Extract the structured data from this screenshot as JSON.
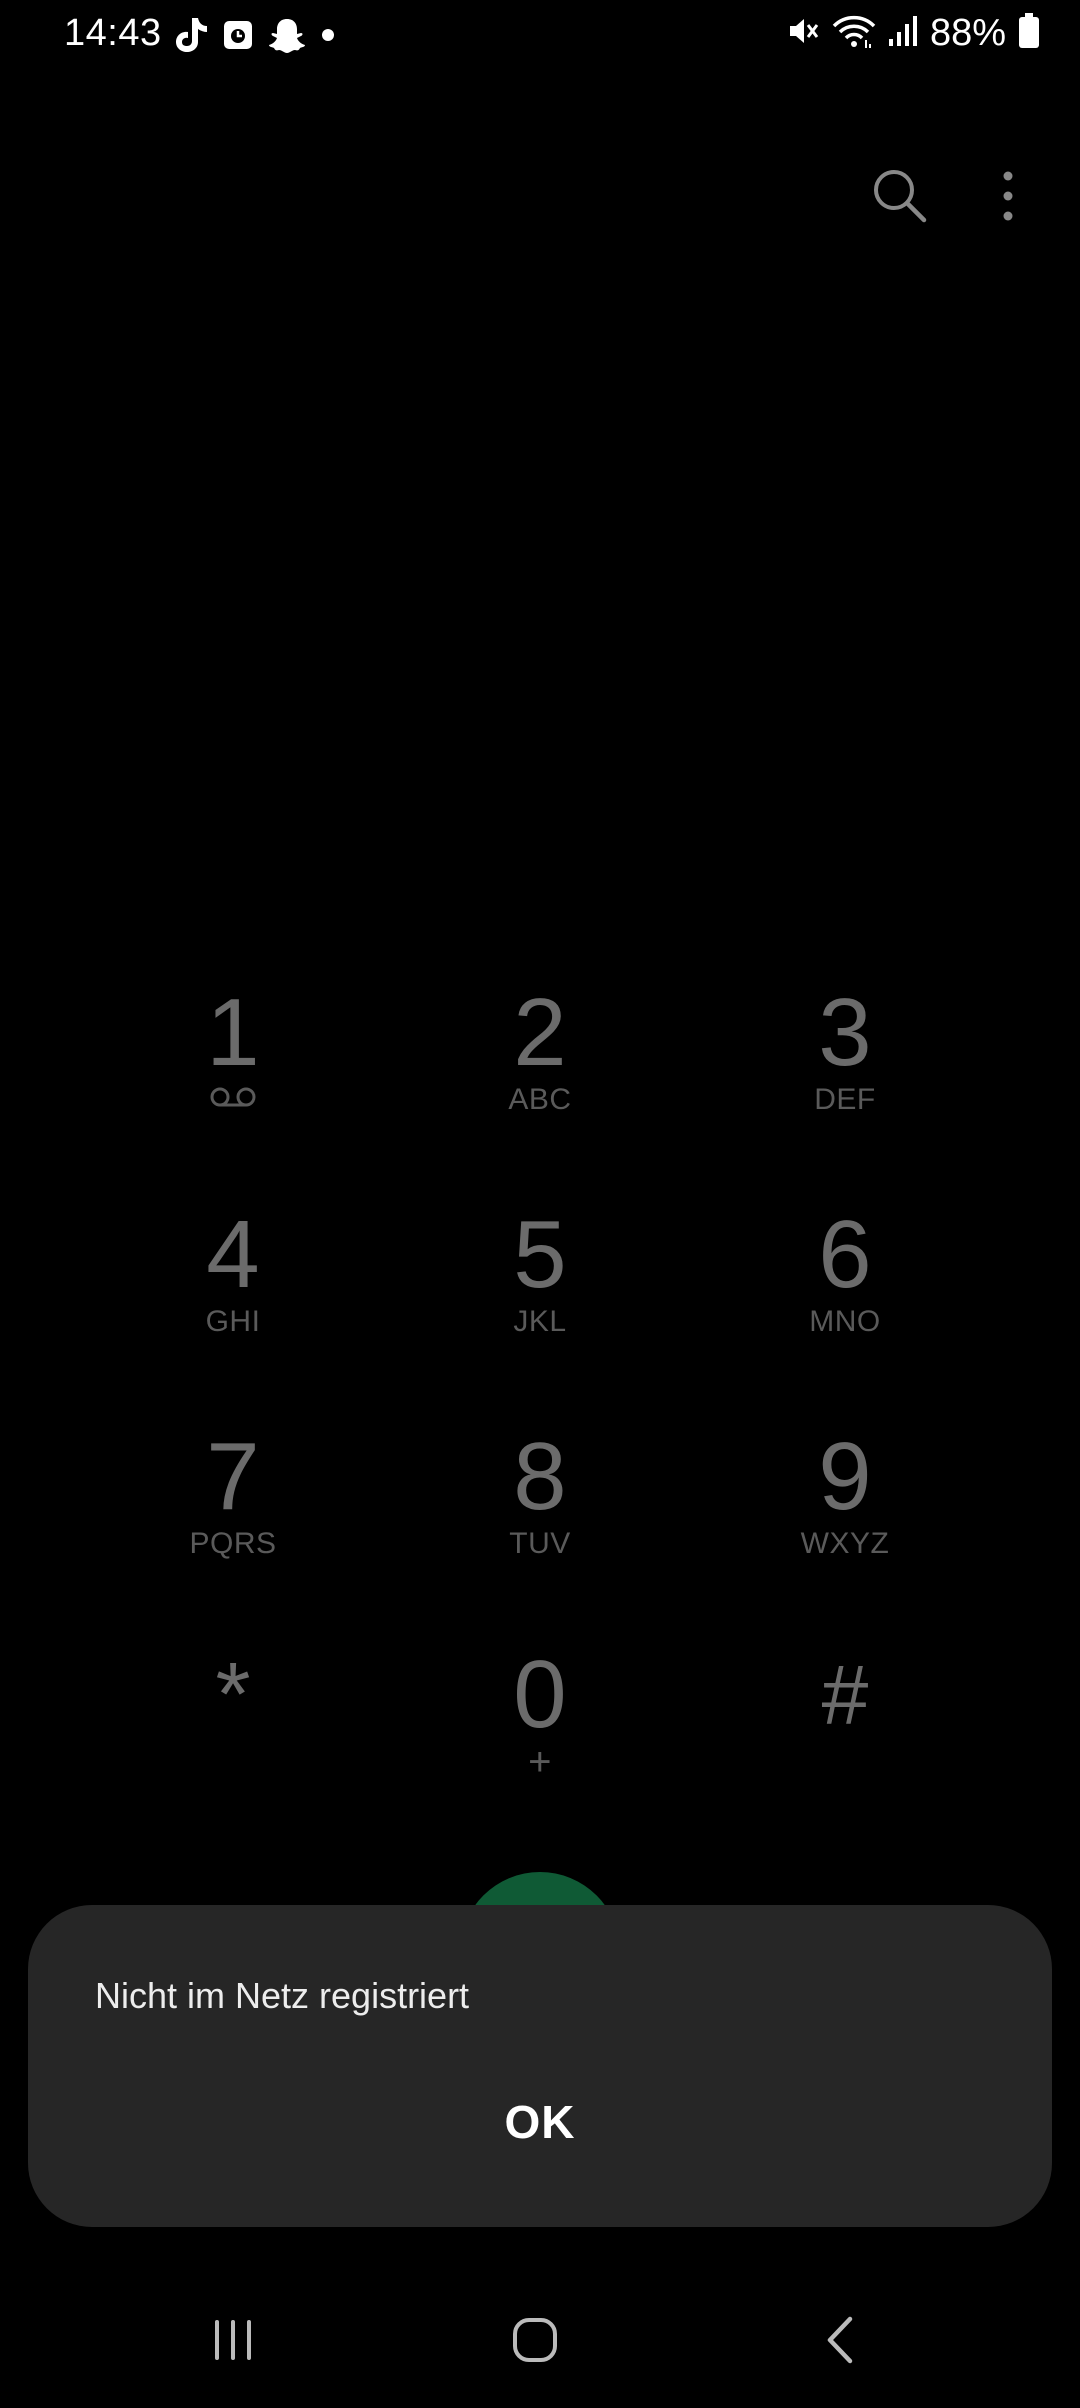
{
  "status_bar": {
    "time": "14:43",
    "battery_percent": "88%",
    "left_icons": [
      "tiktok-icon",
      "calendar-app-icon",
      "snapchat-icon",
      "dot-icon"
    ],
    "right_icons": [
      "mute-icon",
      "wifi-icon",
      "signal-icon",
      "battery-icon"
    ]
  },
  "top_actions": {
    "icons": [
      "search-icon",
      "more-options-icon"
    ]
  },
  "keypad": {
    "keys": [
      {
        "digit": "1",
        "letters": ""
      },
      {
        "digit": "2",
        "letters": "ABC"
      },
      {
        "digit": "3",
        "letters": "DEF"
      },
      {
        "digit": "4",
        "letters": "GHI"
      },
      {
        "digit": "5",
        "letters": "JKL"
      },
      {
        "digit": "6",
        "letters": "MNO"
      },
      {
        "digit": "7",
        "letters": "PQRS"
      },
      {
        "digit": "8",
        "letters": "TUV"
      },
      {
        "digit": "9",
        "letters": "WXYZ"
      },
      {
        "digit": "*",
        "letters": ""
      },
      {
        "digit": "0",
        "letters": "+"
      },
      {
        "digit": "#",
        "letters": ""
      }
    ]
  },
  "dialog": {
    "message": "Nicht im Netz registriert",
    "ok_label": "OK"
  },
  "nav_bar": {
    "icons": [
      "recents-icon",
      "home-icon",
      "back-icon"
    ]
  },
  "colors": {
    "background": "#000000",
    "dialog_background": "#262626",
    "call_button": "#0f5a35",
    "keypad_digit": "#6b6b6b"
  }
}
